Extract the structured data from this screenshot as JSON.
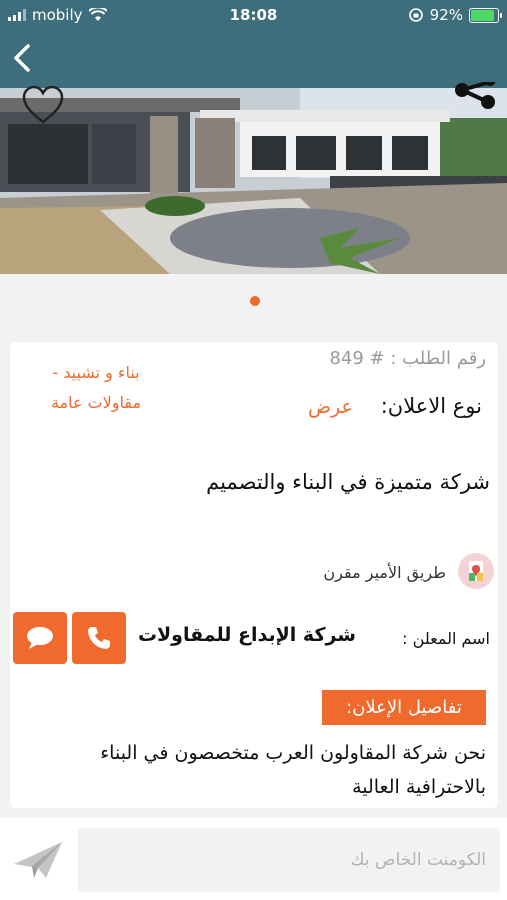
{
  "status_bar": {
    "carrier": "mobily",
    "time": "18:08",
    "battery": "92%",
    "battery_level": 0.92
  },
  "colors": {
    "app_bar": "#3e6e7b",
    "accent": "#ef6a2c"
  },
  "icons": {
    "back": "chevron-left-icon",
    "favorite": "heart-icon",
    "share": "share-icon",
    "location": "map-pin-icon",
    "call": "phone-icon",
    "chat": "chat-bubble-icon",
    "send": "paper-plane-icon"
  },
  "gallery": {
    "active_index": 1,
    "total": 1
  },
  "listing": {
    "order_number": "رقم الطلب : # 849",
    "category": "بناء و تشييد - مقاولات عامة",
    "ad_type_label": "نوع الاعلان:",
    "ad_type_value": "عرض",
    "headline": "شركة متميزة في البناء والتصميم",
    "location": "طريق الأمير مقرن",
    "advertiser_label": "اسم المعلن :",
    "advertiser_name": "شركة الإبداع للمقاولات",
    "details_heading": "تفاصيل الإعلان:",
    "details_text": "نحن شركة المقاولون العرب متخصصون في البناء بالاحترافية العالية"
  },
  "comment": {
    "placeholder": "الكومنت الخاص بك"
  }
}
